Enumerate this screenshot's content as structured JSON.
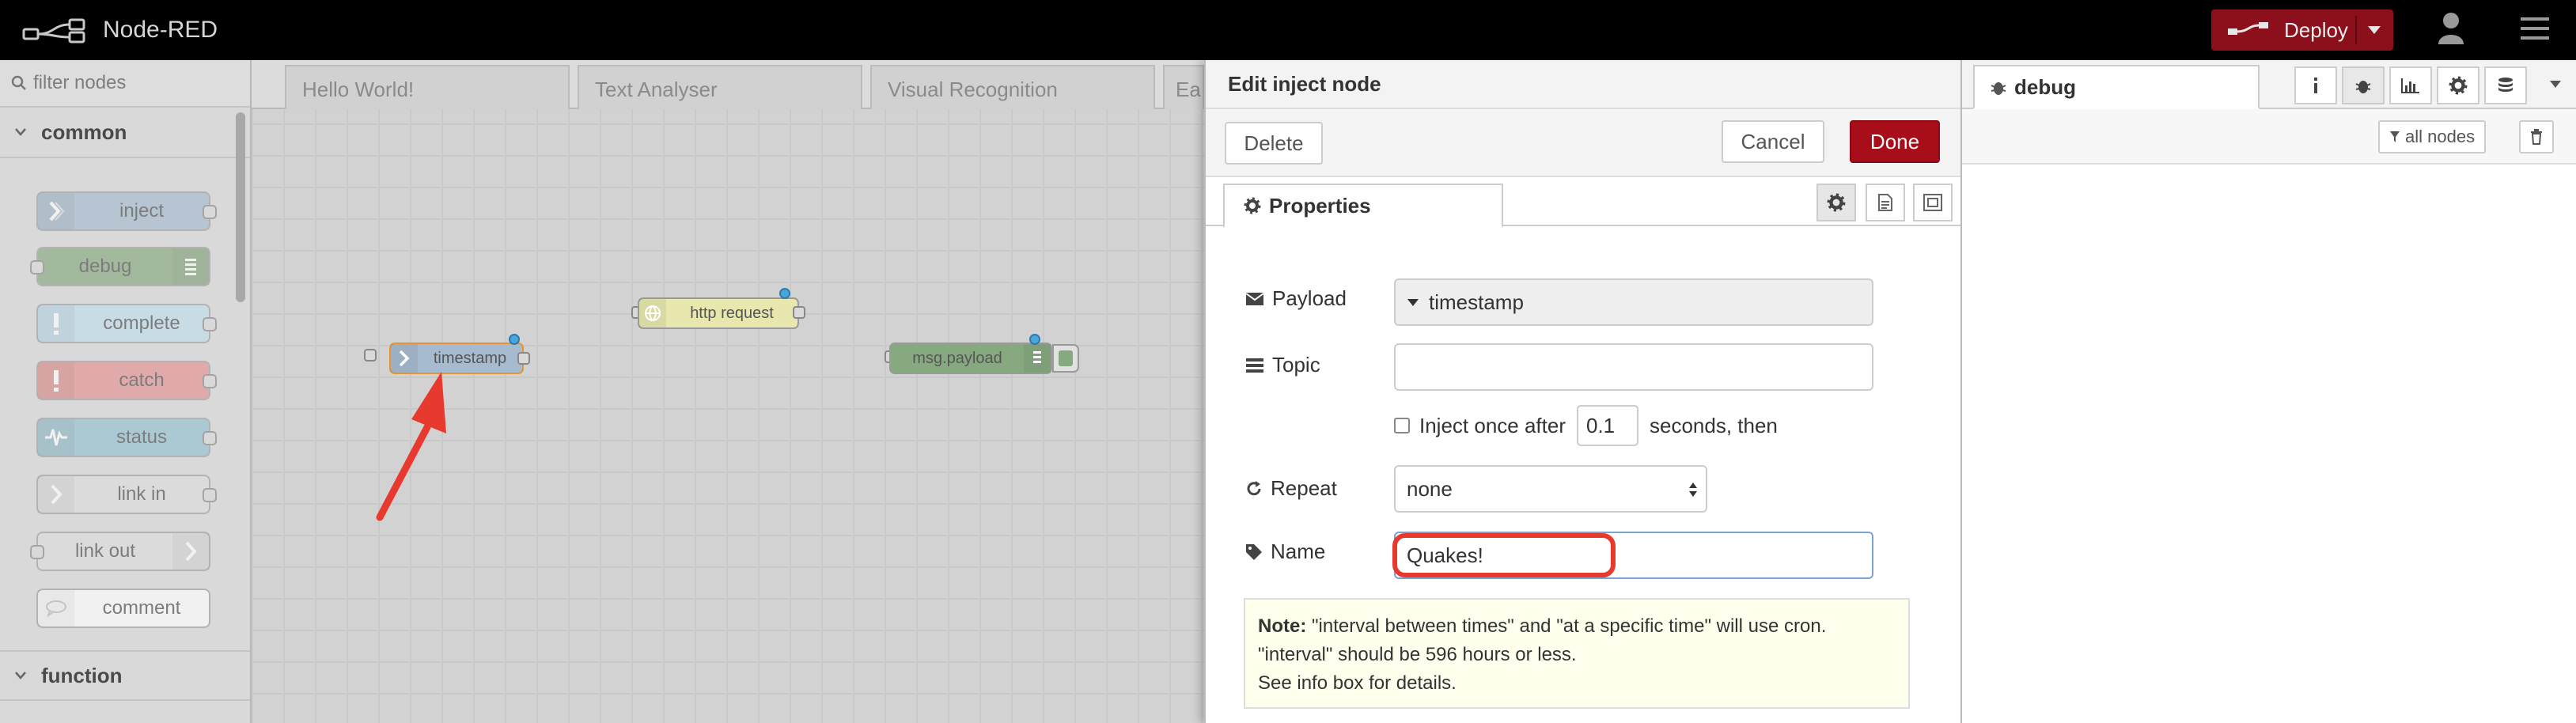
{
  "app": {
    "title": "Node-RED"
  },
  "header": {
    "deploy_label": "Deploy"
  },
  "palette": {
    "search_placeholder": "filter nodes",
    "categories": [
      {
        "name": "common",
        "expanded": true
      },
      {
        "name": "function",
        "expanded": false
      }
    ],
    "nodes": [
      {
        "label": "inject",
        "icon": "inject-arrow-icon",
        "color": "#a6bbcf"
      },
      {
        "label": "debug",
        "icon": "debug-list-icon",
        "color": "#87a980"
      },
      {
        "label": "complete",
        "icon": "exclamation-icon",
        "color": "#c0deed"
      },
      {
        "label": "catch",
        "icon": "exclamation-icon",
        "color": "#e49191"
      },
      {
        "label": "status",
        "icon": "status-pulse-icon",
        "color": "#94c1d0"
      },
      {
        "label": "link in",
        "icon": "link-arrow-icon",
        "color": "#dddddd"
      },
      {
        "label": "link out",
        "icon": "link-arrow-icon",
        "color": "#dddddd"
      },
      {
        "label": "comment",
        "icon": "comment-icon",
        "color": "#ffffff"
      }
    ]
  },
  "workspace": {
    "tabs": [
      "Hello World!",
      "Text Analyser",
      "Visual Recognition",
      "Ea"
    ],
    "nodes": [
      {
        "label": "timestamp",
        "type": "inject",
        "selected": true
      },
      {
        "label": "http request",
        "type": "http request"
      },
      {
        "label": "msg.payload",
        "type": "debug"
      }
    ]
  },
  "tray": {
    "title": "Edit inject node",
    "delete_label": "Delete",
    "cancel_label": "Cancel",
    "done_label": "Done",
    "properties_tab": "Properties",
    "fields": {
      "payload_label": "Payload",
      "payload_value": "timestamp",
      "topic_label": "Topic",
      "topic_value": "",
      "inject_once_label": "Inject once after",
      "inject_once_value": "0.1",
      "inject_once_suffix": "seconds, then",
      "inject_once_checked": false,
      "repeat_label": "Repeat",
      "repeat_value": "none",
      "name_label": "Name",
      "name_value": "Quakes!"
    },
    "note": {
      "bold": "Note:",
      "line1": "\"interval between times\" and \"at a specific time\" will use cron.",
      "line2": "\"interval\" should be 596 hours or less.",
      "line3": "See info box for details."
    }
  },
  "sidebar": {
    "active_tab": "debug",
    "filter_label": "all nodes"
  },
  "colors": {
    "deploy": "#8c101c",
    "done": "#a80d1a",
    "highlight": "#e8392f",
    "inject": "#a6bbcf"
  }
}
